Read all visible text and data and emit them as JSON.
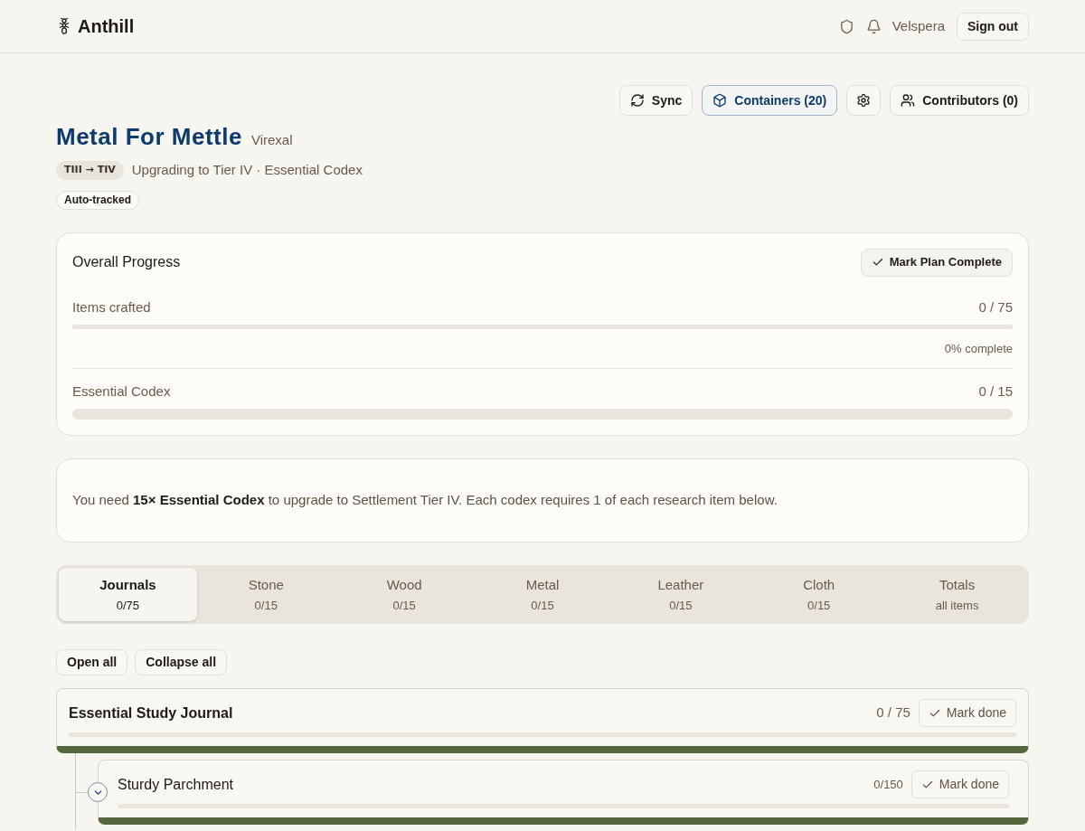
{
  "header": {
    "logo": "Anthill",
    "user": "Velspera",
    "sign_out": "Sign out"
  },
  "toolbar": [
    {
      "kind": "sync",
      "label": "Sync",
      "selected": false
    },
    {
      "kind": "containers",
      "label": "Containers (20)",
      "selected": true
    },
    {
      "kind": "settings",
      "selected": false
    },
    {
      "kind": "contributors",
      "label": "Contributors (0)",
      "selected": false
    }
  ],
  "plan": {
    "title": "Metal For Mettle",
    "owner": "Virexal",
    "tier_badge": "TIII → TIV",
    "subtitle": "Upgrading to Tier IV · Essential Codex",
    "tag": "Auto-tracked"
  },
  "overall": {
    "title": "Overall Progress",
    "button": "Mark Plan Complete",
    "meters": [
      {
        "kind": "line",
        "label": "Items crafted",
        "reading": "0 / 75",
        "level": 0,
        "note": "0% complete"
      },
      {
        "kind": "bar",
        "label": "Essential Codex",
        "reading": "0 / 15",
        "level": 0
      }
    ]
  },
  "info": "You need **15× Essential Codex** to upgrade to Settlement Tier IV. Each codex requires 1 of each research item below.",
  "tabs": [
    {
      "label": "Journals",
      "count": "0/75",
      "selected": true
    },
    {
      "label": "Stone",
      "count": "0/15",
      "selected": false
    },
    {
      "label": "Wood",
      "count": "0/15",
      "selected": false
    },
    {
      "label": "Metal",
      "count": "0/15",
      "selected": false
    },
    {
      "label": "Leather",
      "count": "0/15",
      "selected": false
    },
    {
      "label": "Cloth",
      "count": "0/15",
      "selected": false
    },
    {
      "label": "Totals",
      "count": "all items",
      "selected": false
    }
  ],
  "actions": [
    "Open all",
    "Collapse all"
  ],
  "items": [
    {
      "name": "Essential Study Journal",
      "reading": "0 / 75",
      "level": 0,
      "button": "Mark done",
      "children": [
        {
          "name": "Sturdy Parchment",
          "reading": "0/150",
          "level": 0,
          "button": "Mark done"
        }
      ]
    }
  ]
}
